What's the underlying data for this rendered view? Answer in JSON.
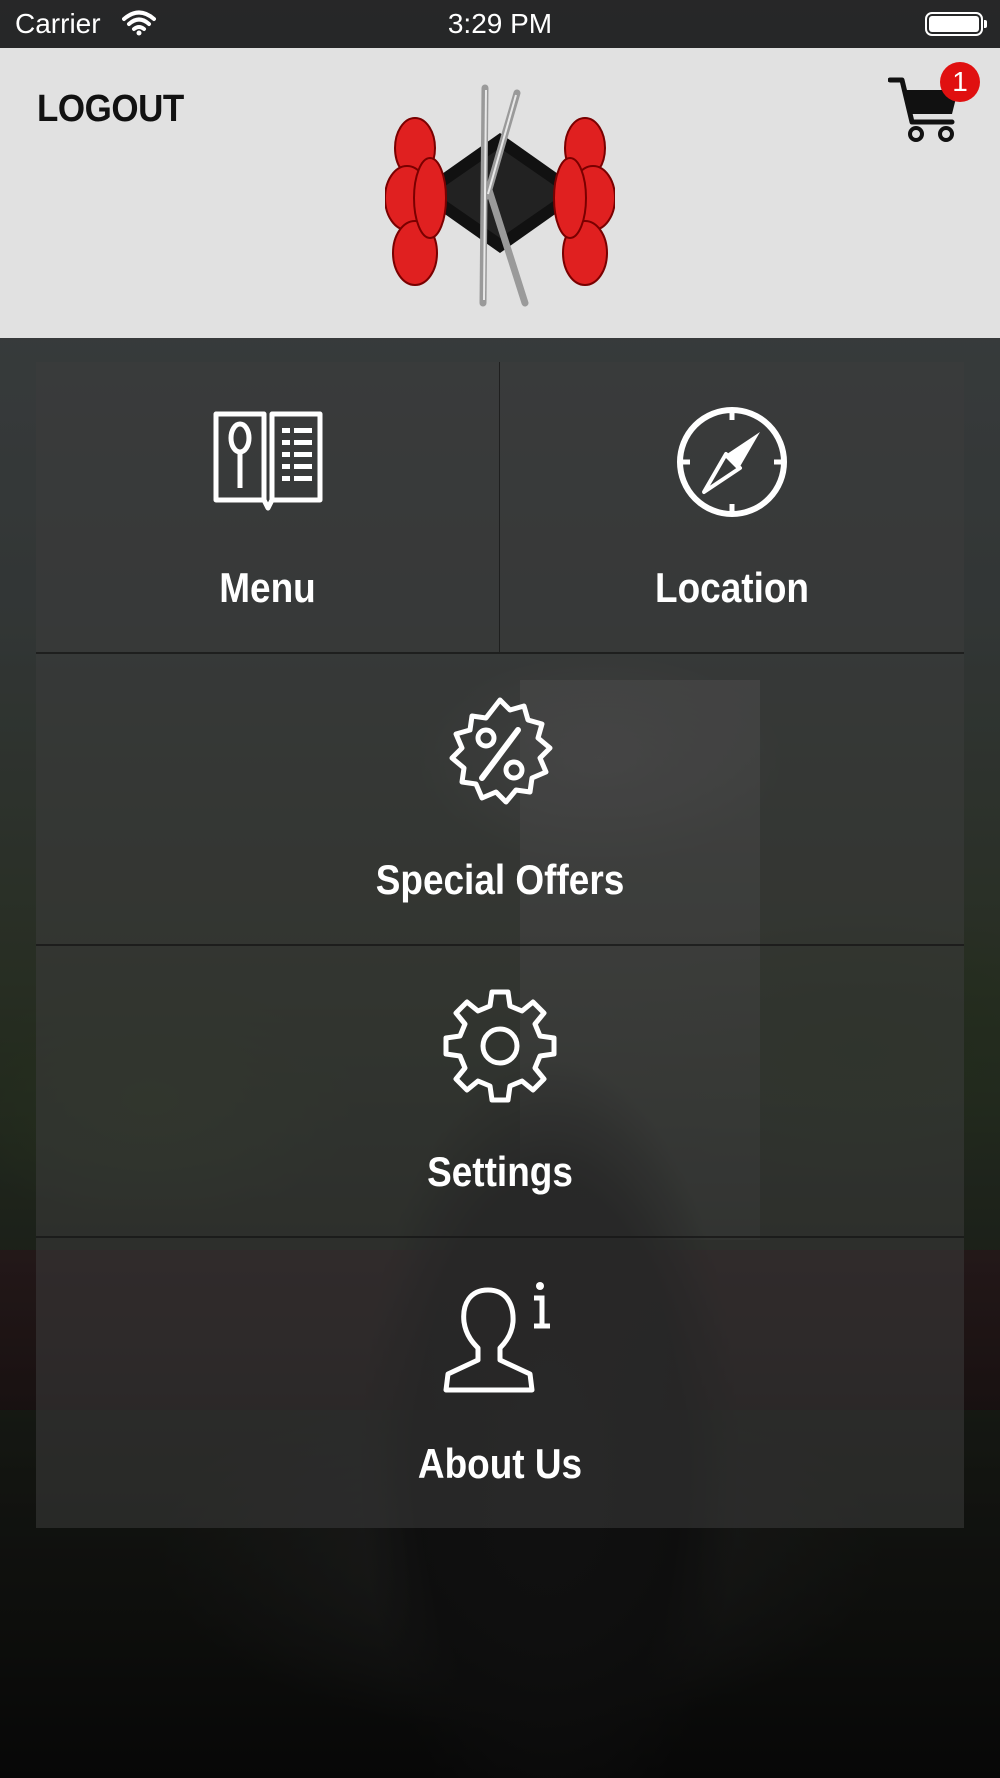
{
  "status_bar": {
    "carrier": "Carrier",
    "time": "3:29 PM"
  },
  "header": {
    "logout_label": "LOGOUT",
    "cart_badge_count": "1",
    "logo_letter": "K"
  },
  "tiles": [
    {
      "label": "Menu",
      "icon": "menu-book-icon"
    },
    {
      "label": "Location",
      "icon": "compass-icon"
    },
    {
      "label": "Special Offers",
      "icon": "percent-badge-icon"
    },
    {
      "label": "Settings",
      "icon": "gear-icon"
    },
    {
      "label": "About Us",
      "icon": "person-info-icon"
    }
  ],
  "colors": {
    "badge": "#e01010",
    "logo_flower": "#e02020"
  }
}
